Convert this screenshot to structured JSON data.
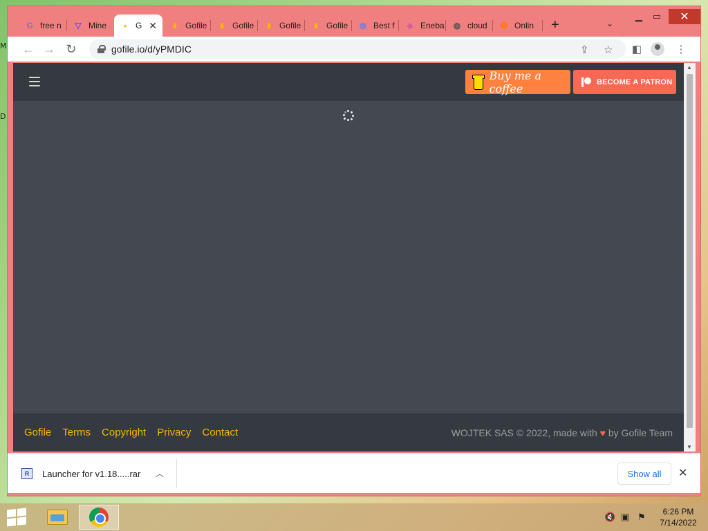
{
  "desktop": {
    "glyph_top": "M",
    "glyph_mid": "D"
  },
  "browser": {
    "tabs": [
      {
        "label": "free n",
        "icon": "google-icon"
      },
      {
        "label": "Mine",
        "icon": "proton-icon"
      },
      {
        "label": "G",
        "icon": "gofile-icon",
        "active": true
      },
      {
        "label": "Gofile",
        "icon": "gofile-icon"
      },
      {
        "label": "Gofile",
        "icon": "gofile-icon"
      },
      {
        "label": "Gofile",
        "icon": "gofile-icon"
      },
      {
        "label": "Gofile",
        "icon": "gofile-icon"
      },
      {
        "label": "Best f",
        "icon": "globe-icon"
      },
      {
        "label": "Eneba",
        "icon": "eneba-icon"
      },
      {
        "label": "cloud",
        "icon": "globe-icon"
      },
      {
        "label": "Onlin",
        "icon": "online-icon"
      }
    ],
    "new_tab": "+",
    "url": "gofile.io/d/yPMDIC"
  },
  "site": {
    "buy_coffee_label": "Buy me a coffee",
    "patron_label": "BECOME A PATRON",
    "footer_links": [
      "Gofile",
      "Terms",
      "Copyright",
      "Privacy",
      "Contact"
    ],
    "credit_before": "WOJTEK SAS © 2022, made with",
    "credit_after": "by Gofile Team"
  },
  "downloads": {
    "file_name": "Launcher for v1.18.....rar",
    "show_all_label": "Show all"
  },
  "taskbar": {
    "time": "6:26 PM",
    "date": "7/14/2022"
  },
  "colors": {
    "browser_frame": "#f08080",
    "page_bg": "#434851",
    "header_bg": "#343a40",
    "link": "#f7b500",
    "coffee": "#ff813f",
    "patreon": "#f96854"
  }
}
